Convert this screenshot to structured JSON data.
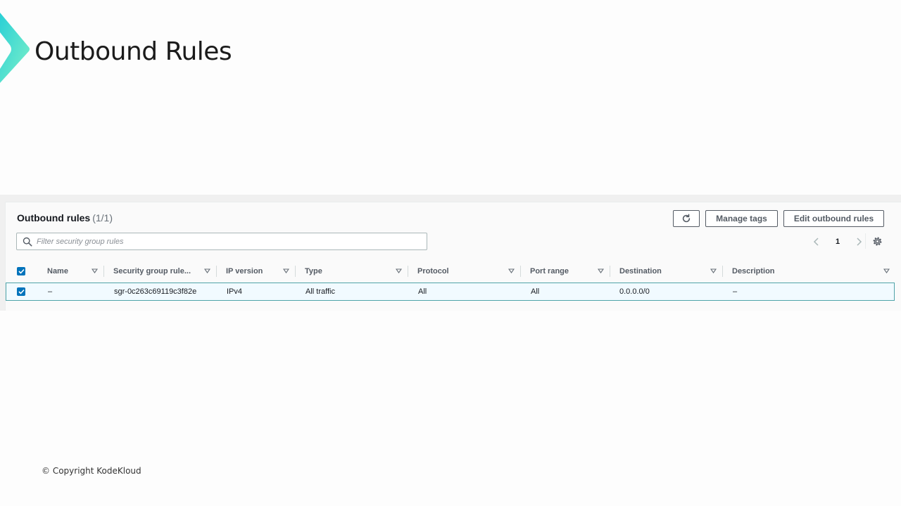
{
  "slide": {
    "title": "Outbound Rules",
    "copyright": "© Copyright KodeKloud"
  },
  "panel": {
    "title": "Outbound rules",
    "count": "(1/1)",
    "buttons": {
      "refresh_icon": "refresh-icon",
      "manage_tags": "Manage tags",
      "edit_outbound_rules": "Edit outbound rules"
    },
    "search": {
      "placeholder": "Filter security group rules",
      "value": ""
    },
    "pagination": {
      "current_page": "1"
    }
  },
  "table": {
    "select_all_checked": true,
    "columns": [
      "Name",
      "Security group rule...",
      "IP version",
      "Type",
      "Protocol",
      "Port range",
      "Destination",
      "Description"
    ],
    "rows": [
      {
        "checked": true,
        "name": "–",
        "security_group_rule": "sgr-0c263c69119c3f82e",
        "ip_version": "IPv4",
        "type": "All traffic",
        "protocol": "All",
        "port_range": "All",
        "destination": "0.0.0.0/0",
        "description": "–"
      }
    ]
  },
  "colors": {
    "accent": "#0073bb",
    "logo_teal": "#3fd6d0",
    "selected_row_bg": "#f1faff"
  }
}
